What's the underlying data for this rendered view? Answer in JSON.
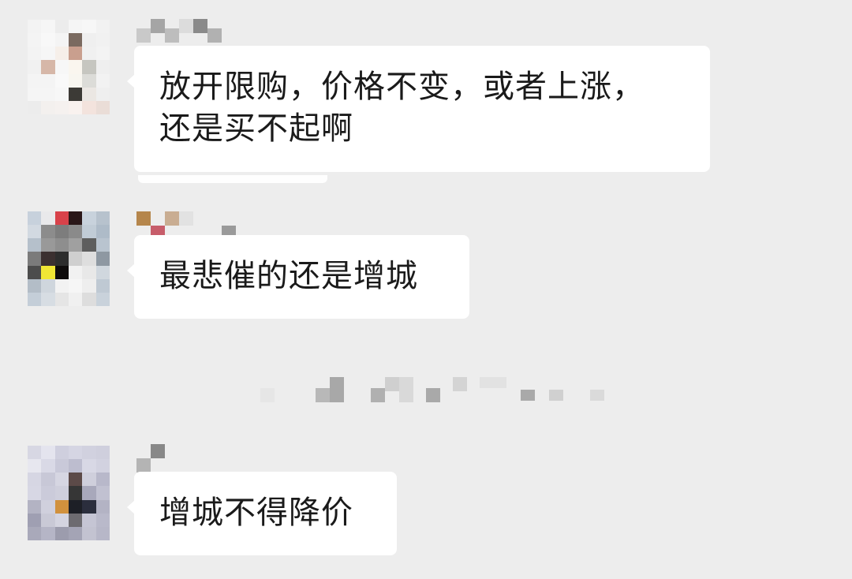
{
  "chat": {
    "messages": [
      {
        "sender": "masked",
        "text_line1": "放开限购，价格不变，或者上涨，",
        "text_line2": "还是买不起啊"
      },
      {
        "sender": "masked",
        "text_line1": "最悲催的还是增城"
      },
      {
        "sender": "masked",
        "text_line1": "增城不得降价"
      }
    ],
    "system_notice": "masked"
  },
  "colors": {
    "background": "#ededed",
    "bubble": "#ffffff",
    "text": "#1a1a1a"
  }
}
